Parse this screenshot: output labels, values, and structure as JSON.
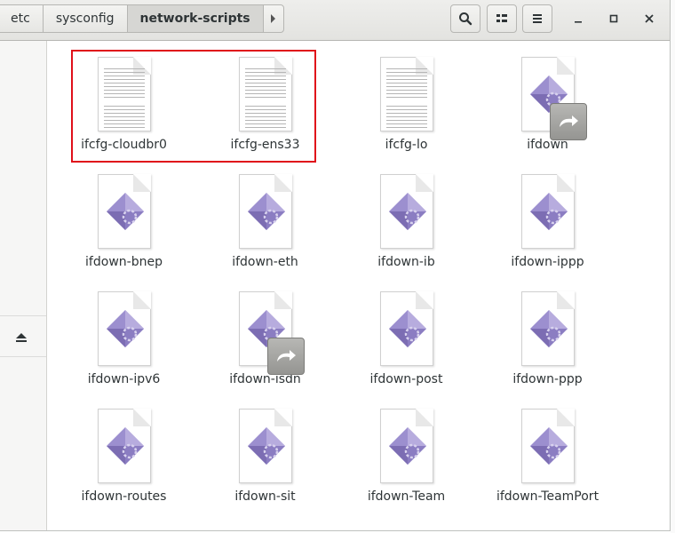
{
  "breadcrumb": {
    "items": [
      "etc",
      "sysconfig",
      "network-scripts"
    ],
    "active_index": 2
  },
  "toolbar": {
    "search_icon": "search-icon",
    "view_icon": "grid-view-icon",
    "menu_icon": "hamburger-menu-icon"
  },
  "window_controls": {
    "minimize": "–",
    "maximize": "□",
    "close": "×"
  },
  "sidebar": {
    "eject_icon": "eject-icon"
  },
  "files": [
    {
      "name": "ifcfg-cloudbr0",
      "type": "text"
    },
    {
      "name": "ifcfg-ens33",
      "type": "text"
    },
    {
      "name": "ifcfg-lo",
      "type": "text"
    },
    {
      "name": "ifdown",
      "type": "script-link"
    },
    {
      "name": "ifdown-bnep",
      "type": "script"
    },
    {
      "name": "ifdown-eth",
      "type": "script"
    },
    {
      "name": "ifdown-ib",
      "type": "script"
    },
    {
      "name": "ifdown-ippp",
      "type": "script"
    },
    {
      "name": "ifdown-ipv6",
      "type": "script"
    },
    {
      "name": "ifdown-isdn",
      "type": "script-link"
    },
    {
      "name": "ifdown-post",
      "type": "script"
    },
    {
      "name": "ifdown-ppp",
      "type": "script"
    },
    {
      "name": "ifdown-routes",
      "type": "script"
    },
    {
      "name": "ifdown-sit",
      "type": "script"
    },
    {
      "name": "ifdown-Team",
      "type": "script"
    },
    {
      "name": "ifdown-TeamPort",
      "type": "script"
    }
  ],
  "colors": {
    "selection_highlight": "#e0101a",
    "script_gem": "#8a7bbf"
  }
}
